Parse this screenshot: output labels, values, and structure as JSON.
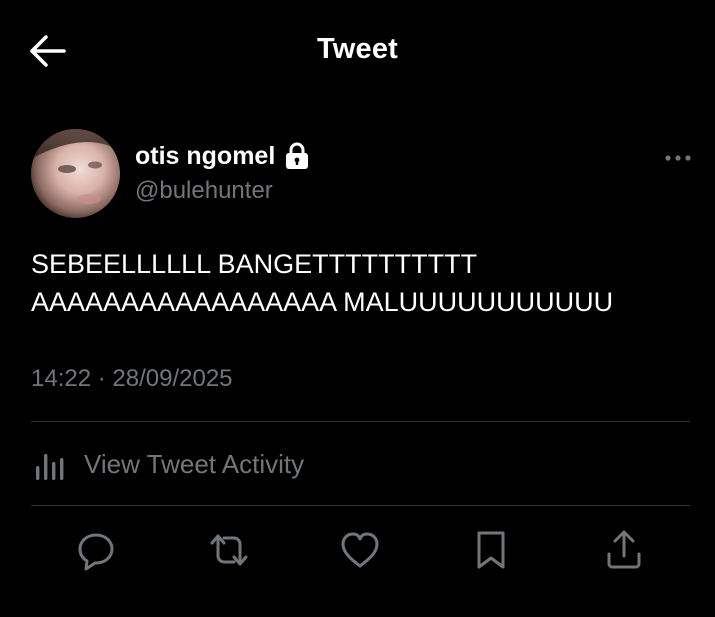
{
  "header": {
    "title": "Tweet",
    "back_icon": "arrow-left-icon"
  },
  "tweet": {
    "author": {
      "display_name": "otis ngomel",
      "handle": "@bulehunter",
      "protected_icon": "lock-icon"
    },
    "text_lines": [
      "SEBEELLLLLL BANGETTTTTTTTTT",
      "AAAAAAAAAAAAAAAAA MALUUUUUUUUUUU"
    ],
    "time": "14:22",
    "separator": " · ",
    "date": "28/09/2025"
  },
  "activity": {
    "label": "View Tweet Activity",
    "icon": "bar-chart-icon"
  },
  "actions": [
    {
      "name": "reply",
      "icon": "reply-icon"
    },
    {
      "name": "retweet",
      "icon": "retweet-icon"
    },
    {
      "name": "like",
      "icon": "heart-icon"
    },
    {
      "name": "bookmark",
      "icon": "bookmark-icon"
    },
    {
      "name": "share",
      "icon": "share-icon"
    }
  ],
  "colors": {
    "background": "#000000",
    "primary_text": "#ffffff",
    "secondary_text": "#71767b",
    "divider": "#2f3336"
  }
}
